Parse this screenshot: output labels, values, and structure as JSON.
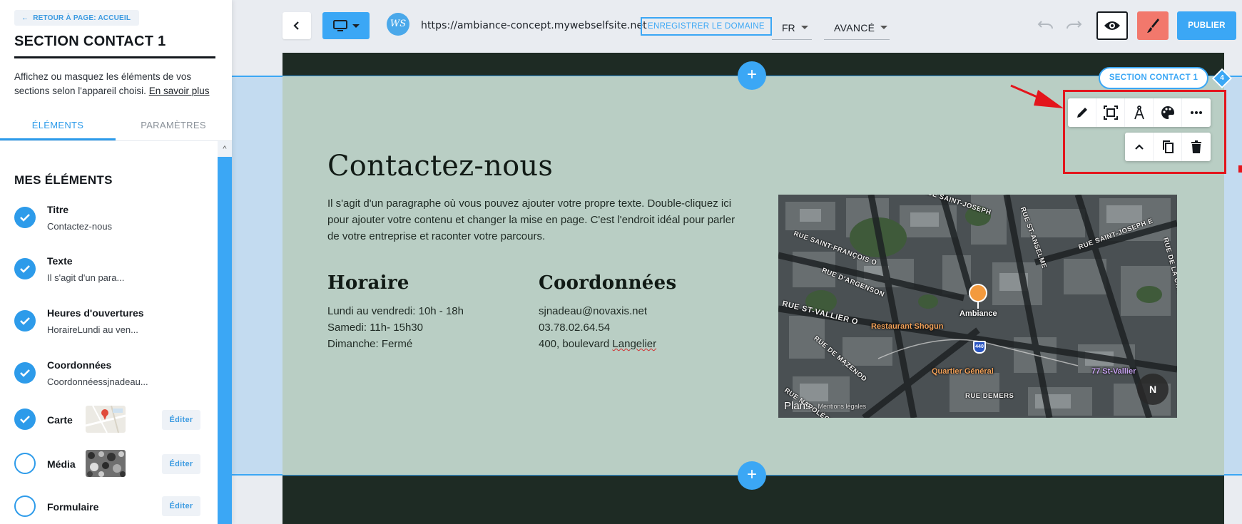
{
  "sidebar": {
    "back_label": "Retour à page: Accueil",
    "title": "SECTION CONTACT 1",
    "help_text": "Affichez ou masquez les éléments de vos sections selon l'appareil choisi.",
    "help_link": "En savoir plus",
    "tabs": [
      "Éléments",
      "Paramètres"
    ],
    "list_heading": "MES ÉLÉMENTS",
    "edit_label": "Éditer",
    "items": [
      {
        "name": "Titre",
        "sub": "Contactez-nous",
        "checked": true
      },
      {
        "name": "Texte",
        "sub": "Il s'agit d'un para...",
        "checked": true
      },
      {
        "name": "Heures d'ouvertures",
        "sub": "HoraireLundi au ven...",
        "checked": true
      },
      {
        "name": "Coordonnées",
        "sub": "Coordonnéessjnadeau...",
        "checked": true
      },
      {
        "name": "Carte",
        "checked": true,
        "thumb": "map-thumbnail"
      },
      {
        "name": "Média",
        "checked": false,
        "thumb": "media-thumbnail"
      },
      {
        "name": "Formulaire",
        "checked": false
      }
    ]
  },
  "toolbar": {
    "url": "https://ambiance-concept.mywebselfsite.net",
    "register_domain": "Enregistrer le domaine",
    "language": "FR",
    "advanced": "Avancé",
    "publish": "Publier",
    "logo_text": "WS"
  },
  "section": {
    "badge": "SECTION CONTACT 1",
    "badge_number": "4",
    "title": "Contactez-nous",
    "paragraph": "Il s'agit d'un paragraphe où vous pouvez ajouter votre propre texte. Double-cliquez ici pour ajouter votre contenu et changer la mise en page. C'est l'endroit idéal pour parler de votre entreprise et raconter votre parcours.",
    "hours": {
      "heading": "Horaire",
      "lines": [
        "Lundi au vendredi: 10h - 18h",
        "Samedi: 11h- 15h30",
        "Dimanche: Fermé"
      ]
    },
    "contact": {
      "heading": "Coordonnées",
      "email": "sjnadeau@novaxis.net",
      "phone": "03.78.02.64.54",
      "address_prefix": "400, boulevard ",
      "address_street": "Langelier"
    },
    "add_symbol": "+"
  },
  "map": {
    "streets": [
      "RUE SAINT-FRANÇOIS O",
      "RUE D'ARGENSON",
      "RUE ST-VALLIER O",
      "RUE DE MAZENOD",
      "RUE ST-ANSELME",
      "RUE SAINT-JOSEPH E",
      "RUE DE LA CHAPELLE",
      "RUE DEMERS",
      "RUE NAPOLÉON",
      "RUE SAINT-JOSEPH"
    ],
    "pin_label": "Ambiance",
    "pois": [
      "Restaurant Shogun",
      "Quartier Général",
      "77 St-Vallier"
    ],
    "highway": "440",
    "attribution": "Plans",
    "legal": "Mentions légales",
    "compass": "N"
  },
  "colors": {
    "accent": "#3ba7f5",
    "section_bg": "#b9cec4",
    "dark_band": "#1e2b24",
    "highlight": "#e3151c",
    "design_button": "#f2786c"
  }
}
